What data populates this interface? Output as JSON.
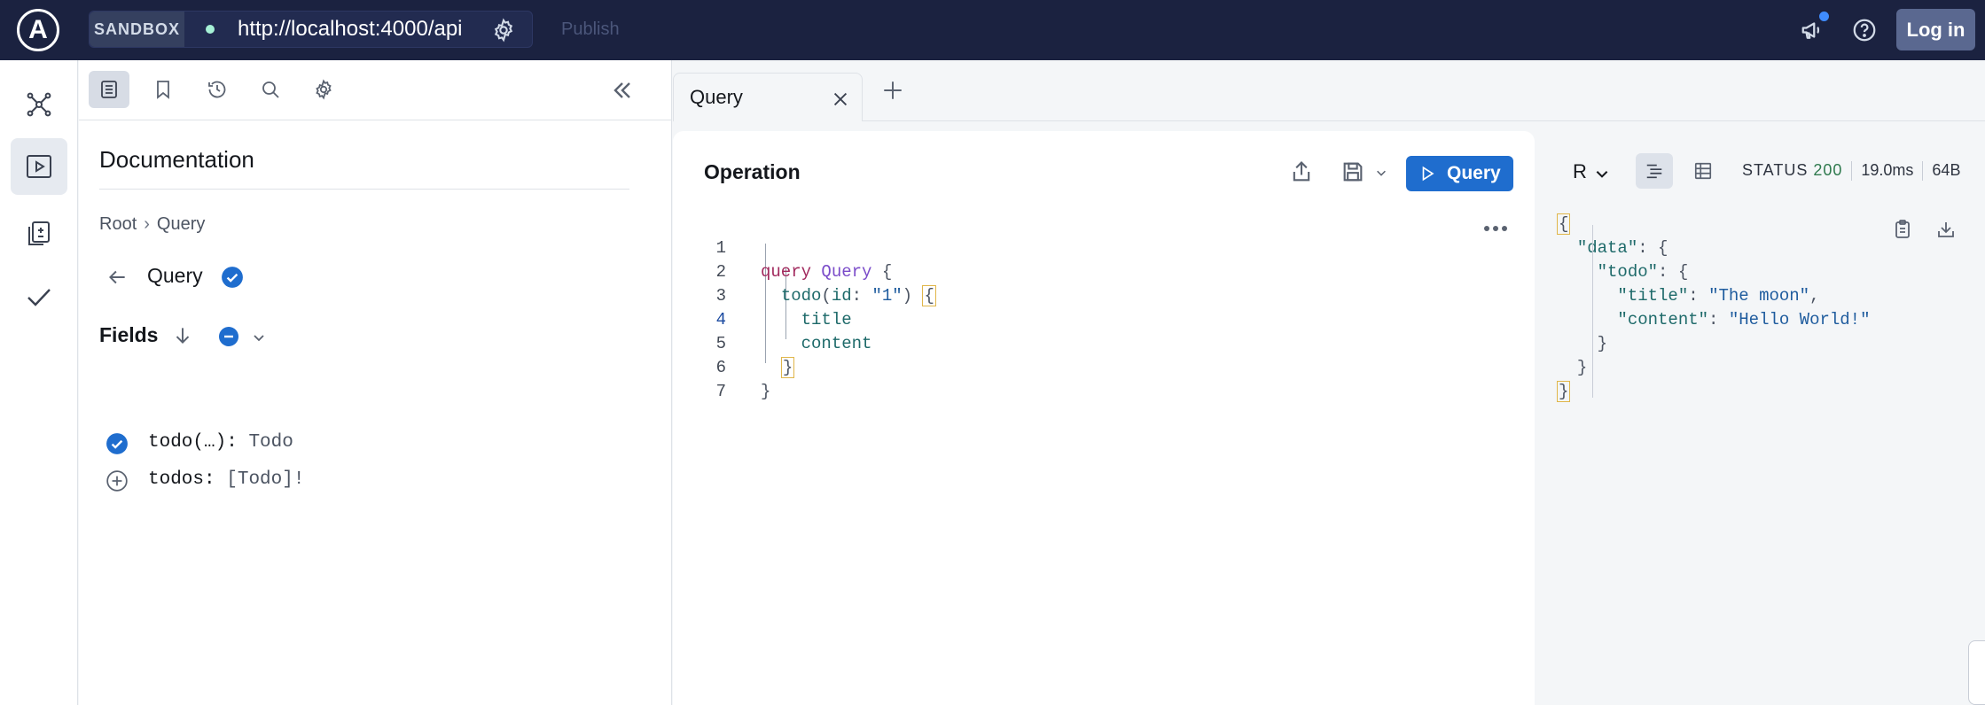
{
  "topbar": {
    "logo_text": "A",
    "sandbox_label": "SANDBOX",
    "endpoint_url": "http://localhost:4000/api",
    "publish_label": "Publish",
    "login_label": "Log in",
    "icons": [
      "announcement-icon",
      "help-icon",
      "settings-gear-icon"
    ]
  },
  "rail": {
    "items": [
      {
        "name": "schema",
        "icon": "graph-nodes-icon",
        "active": false
      },
      {
        "name": "explorer",
        "icon": "play-square-icon",
        "active": true
      },
      {
        "name": "changelog",
        "icon": "diff-files-icon",
        "active": false
      },
      {
        "name": "checks",
        "icon": "checkmark-icon",
        "active": false
      }
    ]
  },
  "docs": {
    "toolbar_icons": [
      "documentation-icon",
      "bookmark-icon",
      "history-icon",
      "search-icon",
      "settings-icon"
    ],
    "title": "Documentation",
    "breadcrumb": {
      "root": "Root",
      "separator": "›",
      "current": "Query"
    },
    "type_name": "Query",
    "fields_label": "Fields",
    "fields": [
      {
        "name": "todo(…)",
        "colon": ":",
        "type": "Todo",
        "selected": true
      },
      {
        "name": "todos",
        "colon": ":",
        "type": "[Todo]!",
        "selected": false
      }
    ]
  },
  "tabs": {
    "items": [
      {
        "label": "Query",
        "active": true
      }
    ]
  },
  "operation": {
    "title": "Operation",
    "run_label": "Query",
    "current_line": 4,
    "lines": [
      {
        "n": "1"
      },
      {
        "n": "2"
      },
      {
        "n": "3"
      },
      {
        "n": "4"
      },
      {
        "n": "5"
      },
      {
        "n": "6"
      },
      {
        "n": "7"
      }
    ],
    "code": {
      "l1_kw": "query",
      "l1_name": "Query",
      "l1_brace": "{",
      "l2_field": "todo",
      "l2_open": "(",
      "l2_arg": "id",
      "l2_colon": ":",
      "l2_str": "\"1\"",
      "l2_close": ")",
      "l2_brace": "{",
      "l3_field": "title",
      "l4_field": "content",
      "l5_brace": "}",
      "l6_brace": "}"
    }
  },
  "response": {
    "mode_label": "R",
    "status_label": "STATUS",
    "status_code": "200",
    "time": "19.0ms",
    "size": "64B",
    "json": {
      "open": "{",
      "data_key": "\"data\"",
      "todo_key": "\"todo\"",
      "title_key": "\"title\"",
      "title_val": "\"The moon\"",
      "content_key": "\"content\"",
      "content_val": "\"Hello World!\"",
      "close_inner": "}",
      "close_data": "}",
      "close": "}"
    }
  },
  "colors": {
    "topbar_bg": "#1b2240",
    "accent_blue": "#1f6dce",
    "login_bg": "#5a6890",
    "status_green": "#2f7a4e"
  }
}
